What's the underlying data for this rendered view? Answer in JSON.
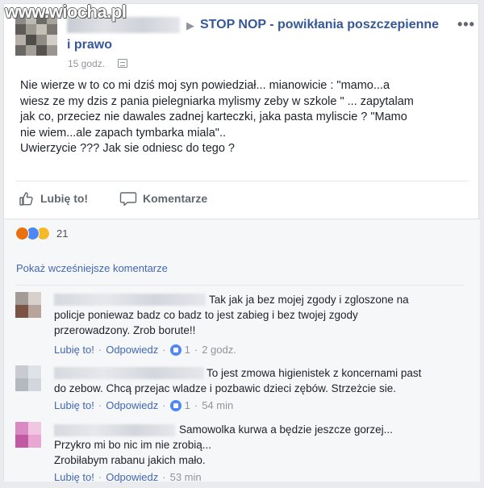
{
  "watermark": "www.wiocha.pl",
  "header": {
    "group_name_line1": "STOP NOP - powikłania poszczepienne",
    "group_name_line2": "i prawo",
    "time": "15 godz.",
    "more": "•••",
    "arrow": "▶"
  },
  "post": {
    "lines": [
      "Nie wierze w to co mi dziś moj syn powiedział... mianowicie : \"mamo...a",
      "wiesz ze my dzis z pania pielegniarka mylismy zeby w szkole \" ... zapytalam",
      "jak co, przeciez nie dawales zadnej karteczki, jaka pasta myliscie ? \"Mamo",
      "nie wiem...ale zapach tymbarka miala\"..",
      "Uwierzycie ??? Jak sie odniesc do tego ?"
    ]
  },
  "actions": {
    "like_label": "Lubię to!",
    "comment_label": "Komentarze"
  },
  "reactions": {
    "count": "21",
    "icons": [
      "angry-icon",
      "like-icon",
      "wow-icon"
    ]
  },
  "prev_comments_label": "Pokaż wcześniejsze komentarze",
  "comments": [
    {
      "lines": [
        "Tak jak ja bez mojej zgody i zgloszone na",
        "policje poniewaz badz co badz to jest zabieg i bez twojej zgody",
        "przerowadzony. Zrob borute!!"
      ],
      "like": "Lubię to!",
      "reply": "Odpowiedz",
      "likes": "1",
      "time": "2 godz."
    },
    {
      "lines": [
        "To jest zmowa higienistek z koncernami past",
        "do zebow. Chcą przejac wladze i pozbawic dzieci zębów. Strzeżcie sie."
      ],
      "like": "Lubię to!",
      "reply": "Odpowiedz",
      "likes": "1",
      "time": "54 min"
    },
    {
      "lines": [
        "Samowolka kurwa a będzie jeszcze gorzej...",
        "Przykro mi bo nic im nie zrobią...",
        "Zrobiłabym rabanu jakich mało."
      ],
      "like": "Lubię to!",
      "reply": "Odpowiedz",
      "time": "53 min"
    }
  ],
  "colors": {
    "link": "#365899",
    "accent": "#4267b2",
    "muted": "#90949c"
  }
}
